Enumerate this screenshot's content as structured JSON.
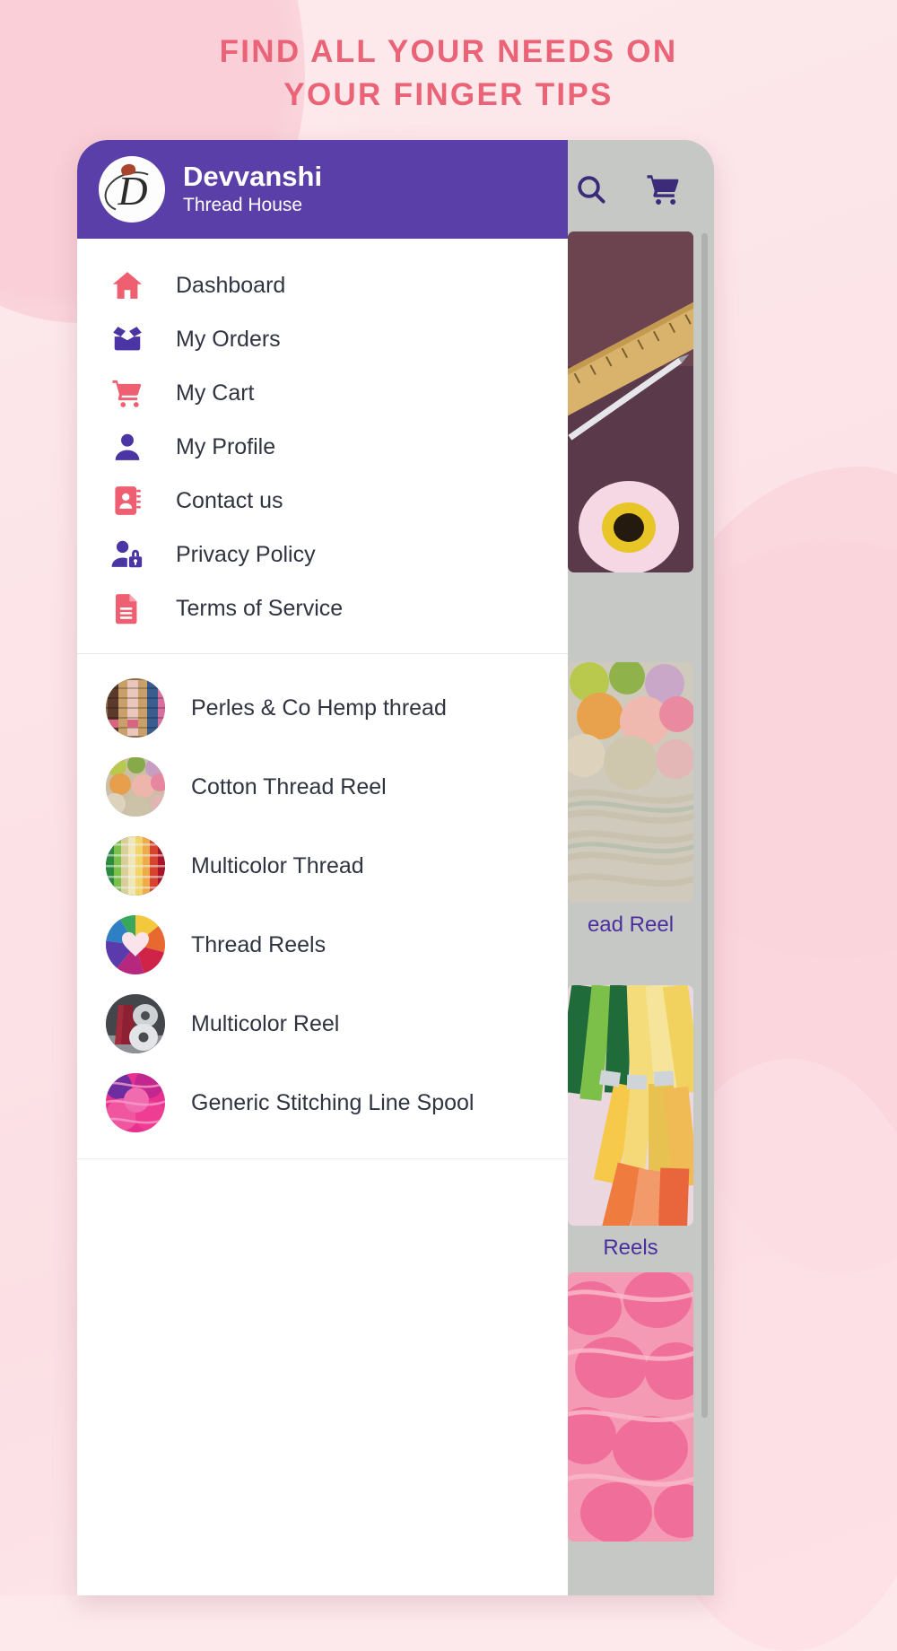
{
  "promo": {
    "headline_line1": "FIND ALL YOUR NEEDS ON",
    "headline_line2": "YOUR FINGER TIPS",
    "headline_color": "#ea6377"
  },
  "app": {
    "accent_purple": "#5b3fa8",
    "accent_pink": "#ef5f72",
    "topbar": {
      "search_icon": "search-icon",
      "cart_icon": "cart-icon"
    },
    "background_cards": [
      {
        "caption": ""
      },
      {
        "caption": "ead Reel"
      },
      {
        "caption": "Reels"
      },
      {
        "caption": ""
      }
    ]
  },
  "drawer": {
    "brand": {
      "name": "Devvanshi",
      "subtitle": "Thread House",
      "logo_icon": "brand-logo-d-monogram"
    },
    "menu": [
      {
        "label": "Dashboard",
        "icon": "home-icon",
        "color": "#ef5f72"
      },
      {
        "label": "My Orders",
        "icon": "open-box-icon",
        "color": "#4b35a5"
      },
      {
        "label": "My Cart",
        "icon": "shopping-cart-icon",
        "color": "#ef5f72"
      },
      {
        "label": "My Profile",
        "icon": "user-icon",
        "color": "#4b35a5"
      },
      {
        "label": "Contact us",
        "icon": "contact-book-icon",
        "color": "#ef5f72"
      },
      {
        "label": "Privacy Policy",
        "icon": "user-lock-icon",
        "color": "#4b35a5"
      },
      {
        "label": "Terms of Service",
        "icon": "document-icon",
        "color": "#ef5f72"
      }
    ],
    "categories": [
      {
        "label": "Perles & Co Hemp thread"
      },
      {
        "label": "Cotton Thread Reel"
      },
      {
        "label": "Multicolor Thread"
      },
      {
        "label": "Thread Reels"
      },
      {
        "label": "Multicolor Reel"
      },
      {
        "label": "Generic Stitching Line Spool"
      }
    ]
  }
}
